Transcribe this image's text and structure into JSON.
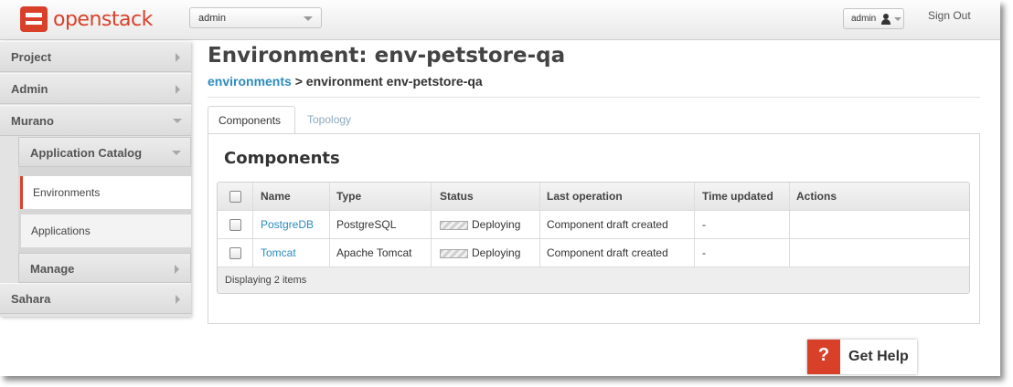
{
  "brand": {
    "name": "openstack",
    "color": "#d9402a"
  },
  "topbar": {
    "project_select_value": "admin",
    "user_menu_label": "admin",
    "signout_label": "Sign Out"
  },
  "sidebar": {
    "items": [
      {
        "label": "Project"
      },
      {
        "label": "Admin"
      },
      {
        "label": "Murano"
      }
    ],
    "murano_sub": {
      "app_catalog_label": "Application Catalog",
      "environments_label": "Environments",
      "applications_label": "Applications",
      "manage_label": "Manage"
    },
    "sahara_label": "Sahara"
  },
  "main": {
    "title": "Environment: env-petstore-qa",
    "breadcrumb": {
      "link": "environments",
      "separator": " > ",
      "current": "environment env-petstore-qa"
    },
    "tabs": [
      {
        "label": "Components"
      },
      {
        "label": "Topology"
      }
    ],
    "panel_title": "Components",
    "table": {
      "headers": [
        "Name",
        "Type",
        "Status",
        "Last operation",
        "Time updated",
        "Actions"
      ],
      "rows": [
        {
          "name": "PostgreDB",
          "type": "PostgreSQL",
          "status": "Deploying",
          "last_operation": "Component draft created",
          "time_updated": "-",
          "actions": ""
        },
        {
          "name": "Tomcat",
          "type": "Apache Tomcat",
          "status": "Deploying",
          "last_operation": "Component draft created",
          "time_updated": "-",
          "actions": ""
        }
      ],
      "footer": "Displaying 2 items"
    }
  },
  "help": {
    "icon": "?",
    "label": "Get Help"
  }
}
